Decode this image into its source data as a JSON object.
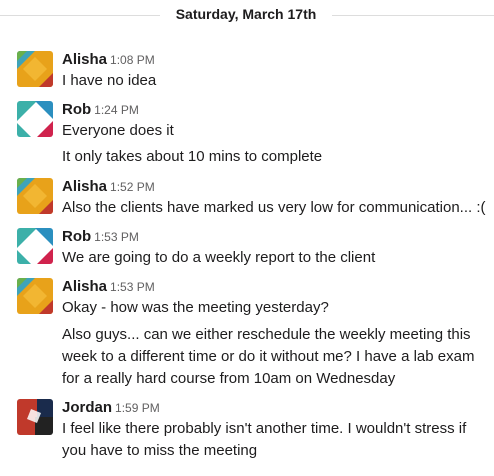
{
  "day_divider": "Saturday, March 17th",
  "messages": [
    {
      "author": "Alisha",
      "time": "1:08 PM",
      "lines": [
        "I have no idea"
      ]
    },
    {
      "author": "Rob",
      "time": "1:24 PM",
      "lines": [
        "Everyone does it"
      ],
      "followups": [
        "It only takes about 10 mins to complete"
      ]
    },
    {
      "author": "Alisha",
      "time": "1:52 PM",
      "lines": [
        "Also the clients have marked us very low for communication... :("
      ]
    },
    {
      "author": "Rob",
      "time": "1:53 PM",
      "lines": [
        "We are going to do a weekly report to the client"
      ]
    },
    {
      "author": "Alisha",
      "time": "1:53 PM",
      "lines": [
        "Okay - how was the meeting yesterday?"
      ],
      "followups": [
        "Also guys... can we either reschedule the weekly meeting this",
        "week to a different time or do it without me? I have a lab exam",
        "for a really hard course from 10am on Wednesday"
      ]
    },
    {
      "author": "Jordan",
      "time": "1:59 PM",
      "lines": [
        "I feel like there probably isn't another time. I wouldn't stress if",
        "you have to miss the meeting"
      ]
    }
  ],
  "avatars": {
    "alisha": {
      "colors": [
        "#e8a21a",
        "#3fa3b9",
        "#6ab04c",
        "#c0392b"
      ]
    },
    "rob": {
      "colors": [
        "#ffffff",
        "#3cb0a9",
        "#2b8fbf",
        "#d0234d"
      ]
    },
    "jordan": {
      "colors": [
        "#c0392b",
        "#1a2b4c",
        "#e6e6e6",
        "#222222"
      ]
    }
  }
}
